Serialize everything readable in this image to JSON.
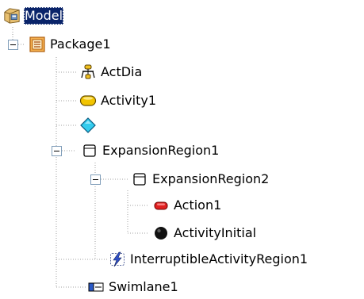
{
  "tree": {
    "root": {
      "label": "Model",
      "icon": "model-folder-icon",
      "selected": true
    },
    "package": {
      "label": "Package1",
      "icon": "package-icon",
      "expanded": true
    },
    "actdia": {
      "label": "ActDia",
      "icon": "activity-diagram-icon"
    },
    "activity1": {
      "label": "Activity1",
      "icon": "activity-icon"
    },
    "decision": {
      "label": "",
      "icon": "decision-node-icon"
    },
    "expansion1": {
      "label": "ExpansionRegion1",
      "icon": "expansion-region-icon",
      "expanded": true
    },
    "expansion2": {
      "label": "ExpansionRegion2",
      "icon": "expansion-region-icon",
      "expanded": true
    },
    "action1": {
      "label": "Action1",
      "icon": "action-icon"
    },
    "initial": {
      "label": "ActivityInitial",
      "icon": "initial-node-icon"
    },
    "interruptible": {
      "label": "InterruptibleActivityRegion1",
      "icon": "interruptible-region-icon"
    },
    "swimlane": {
      "label": "Swimlane1",
      "icon": "swimlane-icon"
    }
  },
  "colors": {
    "selection_bg": "#0a246a",
    "selection_fg": "#ffffff",
    "tree_line": "#a0a0a0",
    "action_red": "#e02020",
    "activity_yellow": "#f2c400",
    "decision_cyan": "#33ccee"
  }
}
